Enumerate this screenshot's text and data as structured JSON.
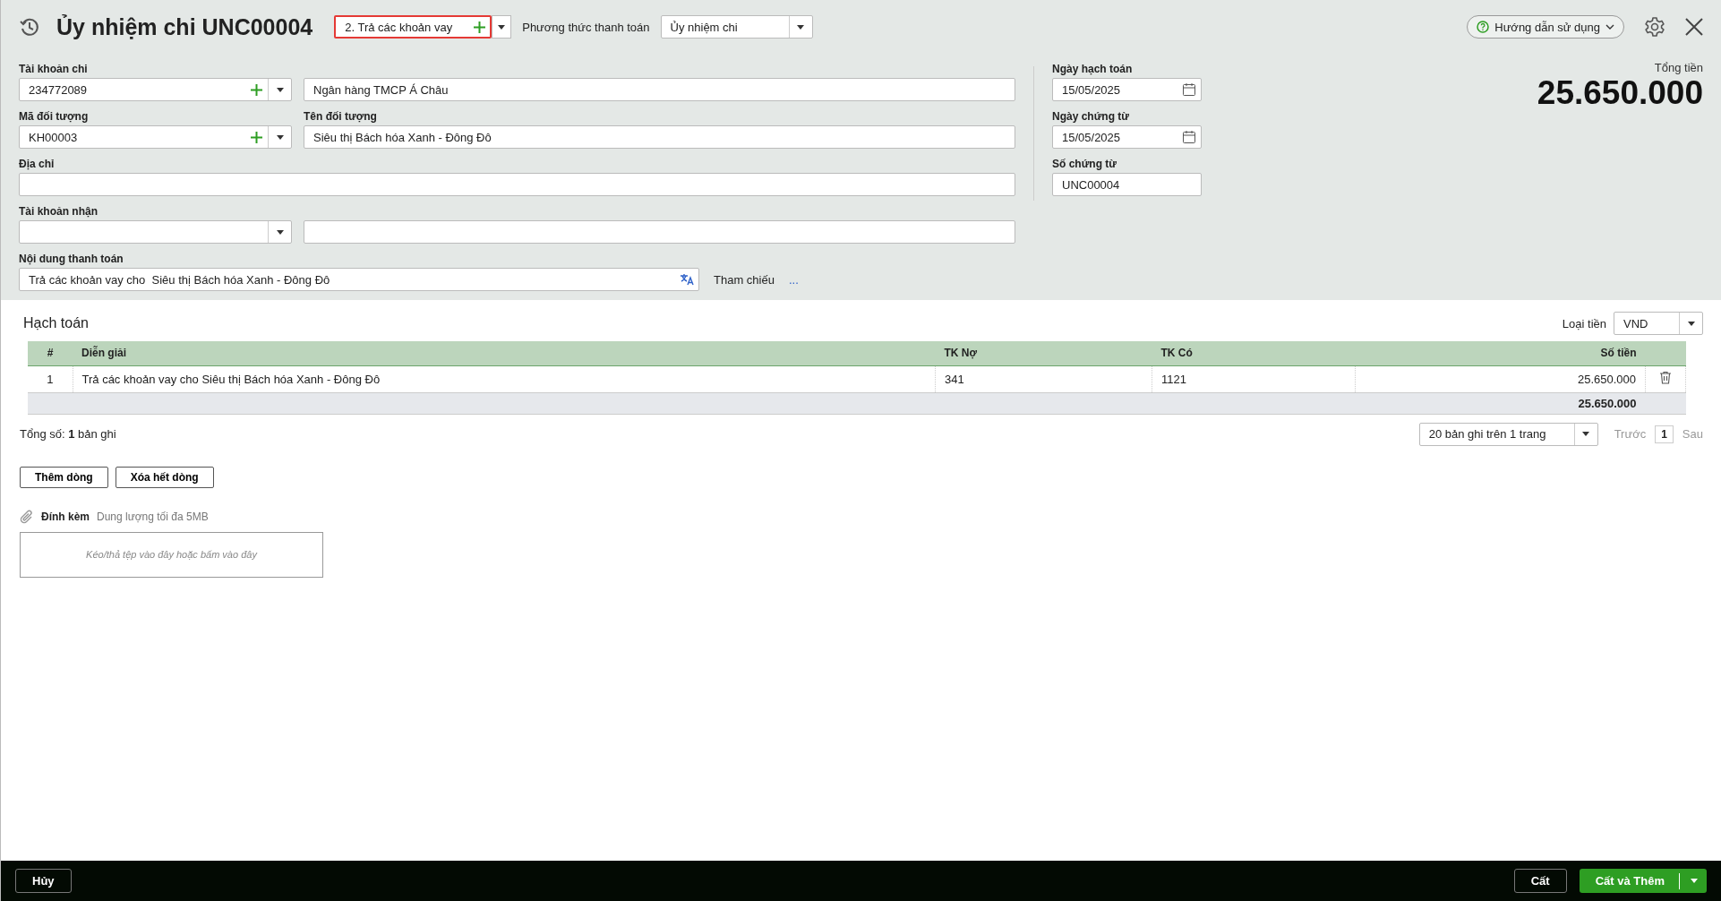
{
  "header": {
    "title": "Ủy nhiệm chi UNC00004",
    "purpose": {
      "value": "2. Trả các khoản vay",
      "highlighted": true
    },
    "method_label": "Phương thức thanh toán",
    "method": "Ủy nhiệm chi",
    "help": "Hướng dẫn sử dụng"
  },
  "form": {
    "paying_account": {
      "label": "Tài khoản chi",
      "value": "234772089",
      "bank": "Ngân hàng TMCP Á Châu"
    },
    "object_code": {
      "label": "Mã đối tượng",
      "value": "KH00003"
    },
    "object_name": {
      "label": "Tên đối tượng",
      "value": "Siêu thị Bách hóa Xanh - Đông Đô"
    },
    "address": {
      "label": "Địa chỉ"
    },
    "receiving_account": {
      "label": "Tài khoản nhận"
    },
    "content": {
      "label": "Nội dung thanh toán",
      "value": "Trả các khoản vay cho  Siêu thị Bách hóa Xanh - Đông Đô"
    },
    "reference": "Tham chiếu",
    "reference_more": "...",
    "posting_date": {
      "label": "Ngày hạch toán",
      "value": "15/05/2025"
    },
    "doc_date": {
      "label": "Ngày chứng từ",
      "value": "15/05/2025"
    },
    "doc_no": {
      "label": "Số chứng từ",
      "value": "UNC00004"
    },
    "total_label": "Tổng tiền",
    "total": "25.650.000"
  },
  "accounting": {
    "title": "Hạch toán",
    "currency_label": "Loại tiền",
    "currency": "VND",
    "columns": [
      "#",
      "Diễn giải",
      "TK Nợ",
      "TK Có",
      "Số tiền"
    ],
    "rows": [
      {
        "cells": [
          "1",
          "Trả các khoản vay cho  Siêu thị Bách hóa Xanh - Đông Đô",
          "341",
          "1121",
          "25.650.000"
        ]
      }
    ],
    "total": "25.650.000",
    "count": "Tổng số: **1** bản ghi",
    "page_size": "20 bản ghi trên 1 trang",
    "prev": {
      "label": "Trước",
      "disabled": true
    },
    "page": "1",
    "next": {
      "label": "Sau",
      "disabled": true
    },
    "buttons": [
      "Thêm dòng",
      "Xóa hết dòng"
    ]
  },
  "attachment": {
    "label": "Đính kèm",
    "hint": "Dung lượng tối đa 5MB",
    "drop": "Kéo/thả tệp vào đây hoặc bấm vào đây"
  },
  "footer": {
    "cancel": "Hủy",
    "save": "Cất",
    "save_add": "Cất và Thêm"
  }
}
